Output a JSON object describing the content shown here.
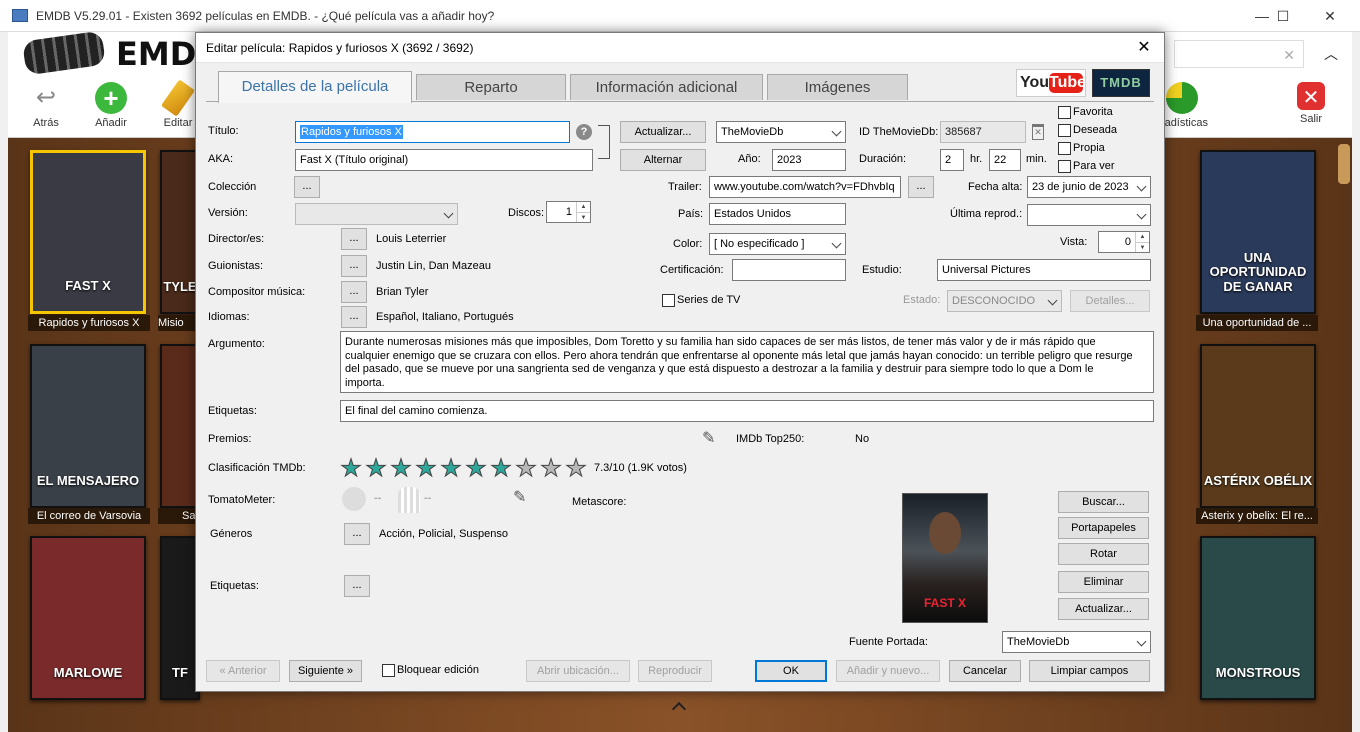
{
  "window": {
    "title": "EMDB V5.29.01 - Existen 3692 películas en EMDB. - ¿Qué película vas a añadir hoy?",
    "minimize": "—",
    "maximize": "☐",
    "close": "✕"
  },
  "logo": {
    "text": "EMDB"
  },
  "toolbar": {
    "back": "Atrás",
    "add": "Añadir",
    "edit": "Editar",
    "stats": "stadísticas",
    "exit": "Salir",
    "search_clear": "✕",
    "collapse": "︿"
  },
  "shelf": {
    "row1": [
      {
        "title": "Rapidos y furiosos X",
        "poster_text": "FAST X",
        "color": "#3a3a44"
      },
      {
        "title": "Misio",
        "poster_text": "TYLE",
        "color": "#4a2a1a"
      },
      {
        "title": "Una oportunidad de ...",
        "poster_text": "UNA OPORTUNIDAD DE GANAR",
        "color": "#2a3a5a"
      }
    ],
    "row2": [
      {
        "title": "El correo de Varsovia",
        "poster_text": "EL MENSAJERO",
        "color": "#3a4048"
      },
      {
        "title": "Sa",
        "poster_text": "",
        "color": "#5a2a1a"
      },
      {
        "title": "Asterix y obelix: El re...",
        "poster_text": "ASTÉRIX OBÉLIX",
        "color": "#5a3a1a"
      }
    ],
    "row3": [
      {
        "title": "",
        "poster_text": "MARLOWE",
        "color": "#7a2a2a"
      },
      {
        "title": "",
        "poster_text": "TF",
        "color": "#1a1a1a"
      },
      {
        "title": "",
        "poster_text": "MONSTROUS",
        "color": "#2a4a4a"
      }
    ]
  },
  "dialog": {
    "title": "Editar película: Rapidos y furiosos X (3692 / 3692)",
    "close": "✕",
    "tabs": [
      "Detalles de la película",
      "Reparto",
      "Información adicional",
      "Imágenes"
    ],
    "youtube": {
      "a": "You",
      "b": "Tube"
    },
    "tmdb": "TMDB",
    "labels": {
      "titulo": "Título:",
      "aka": "AKA:",
      "coleccion": "Colección",
      "version": "Versión:",
      "discos": "Discos:",
      "director": "Director/es:",
      "guionistas": "Guionistas:",
      "compositor": "Compositor música:",
      "idiomas": "Idiomas:",
      "argumento": "Argumento:",
      "etiquetas": "Etiquetas:",
      "premios": "Premios:",
      "clasificacion": "Clasificación TMDb:",
      "tomatometer": "TomatoMeter:",
      "generos": "Géneros",
      "etiquetas2": "Etiquetas:",
      "id_tmdb": "ID TheMovieDb:",
      "anio": "Año:",
      "duracion": "Duración:",
      "hr": "hr.",
      "min": "min.",
      "trailer": "Trailer:",
      "fecha_alta": "Fecha alta:",
      "pais": "País:",
      "ultima": "Última reprod.:",
      "color": "Color:",
      "vista": "Vista:",
      "certificacion": "Certificación:",
      "estudio": "Estudio:",
      "series": "Series de TV",
      "estado": "Estado:",
      "top250": "IMDb Top250:",
      "metascore": "Metascore:",
      "fuente": "Fuente Portada:",
      "favorita": "Favorita",
      "deseada": "Deseada",
      "propia": "Propia",
      "para_ver": "Para ver",
      "bloquear": "Bloquear edición"
    },
    "values": {
      "titulo": "Rapidos y furiosos X",
      "aka": "Fast X (Título original)",
      "discos": "1",
      "director": "Louis Leterrier",
      "guionistas": "Justin Lin, Dan Mazeau",
      "compositor": "Brian Tyler",
      "idiomas": "Español, Italiano, Portugués",
      "source": "TheMovieDb",
      "id_tmdb": "385687",
      "anio": "2023",
      "hr": "2",
      "min": "22",
      "trailer": "www.youtube.com/watch?v=FDhvbIq",
      "fecha_alta": "23 de junio de 2023",
      "pais": "Estados Unidos",
      "color": "[ No especificado ]",
      "vista": "0",
      "certificacion": "",
      "estudio": "Universal Pictures",
      "estado": "DESCONOCIDO",
      "argumento": "Durante numerosas misiones más que imposibles, Dom Toretto y su familia han sido capaces de ser más listos, de tener más valor y de ir más rápido que cualquier enemigo que se cruzara con ellos. Pero ahora tendrán que enfrentarse al oponente más letal que jamás hayan conocido: un terrible peligro que resurge del pasado, que se mueve por una sangrienta sed de venganza y que está dispuesto a destrozar a la familia y destruir para siempre todo lo que a Dom le importa.",
      "etiquetas": "El final del camino comienza.",
      "rating": 7.3,
      "rating_text": "7.3/10  (1.9K votos)",
      "top250": "No",
      "tomato_a": "--",
      "tomato_b": "--",
      "generos": "Acción, Policial, Suspenso",
      "fuente": "TheMovieDb",
      "cover_text": "FAST X"
    },
    "buttons": {
      "actualizar": "Actualizar...",
      "alternar": "Alternar",
      "dots": "...",
      "detalles": "Detalles...",
      "buscar": "Buscar...",
      "portapapeles": "Portapapeles",
      "rotar": "Rotar",
      "eliminar": "Eliminar",
      "actualizar2": "Actualizar...",
      "anterior": "« Anterior",
      "siguiente": "Siguiente »",
      "abrir": "Abrir ubicación...",
      "reproducir": "Reproducir",
      "ok": "OK",
      "anadir": "Añadir y nuevo...",
      "cancelar": "Cancelar",
      "limpiar": "Limpiar campos"
    },
    "help": "?"
  }
}
